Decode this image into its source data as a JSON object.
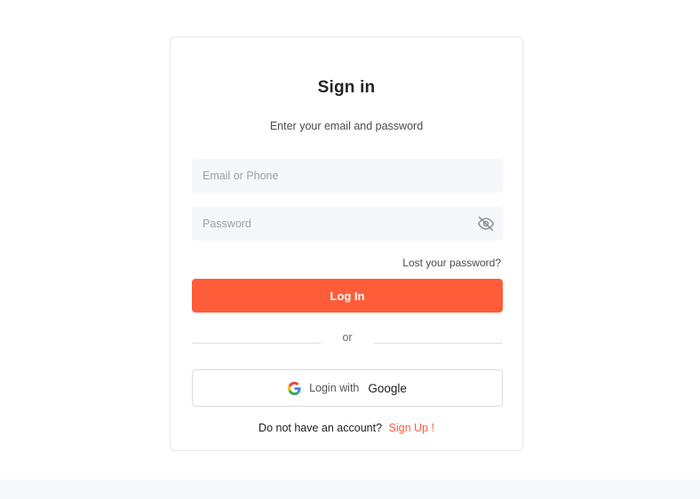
{
  "form": {
    "title": "Sign in",
    "subtitle": "Enter your email and password",
    "email_placeholder": "Email or Phone",
    "email_value": "",
    "password_placeholder": "Password",
    "password_value": "",
    "forgot_label": "Lost your password?",
    "login_label": "Log In",
    "divider_label": "or"
  },
  "social": {
    "prefix": "Login with",
    "provider": "Google",
    "icon": "google-logo-icon"
  },
  "signup": {
    "prompt": "Do not have an account?",
    "link_label": "Sign Up !"
  },
  "colors": {
    "accent": "#ff5c3a",
    "field_bg": "#f6f7fa",
    "border": "#e4e6ea"
  }
}
